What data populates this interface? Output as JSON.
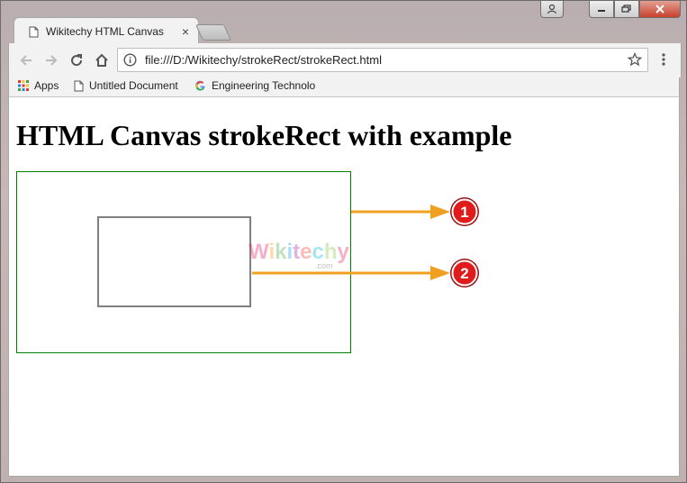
{
  "window": {
    "controls": [
      "profile",
      "minimize",
      "maximize",
      "close"
    ]
  },
  "tabs": [
    {
      "title": "Wikitechy HTML Canvas",
      "close": "×",
      "active": true
    }
  ],
  "toolbar": {
    "url": "file:///D:/Wikitechy/strokeRect/strokeRect.html",
    "icons": [
      "back-icon",
      "forward-icon",
      "reload-icon",
      "home-icon",
      "info-icon",
      "star-icon",
      "menu-icon"
    ]
  },
  "bookmarks": [
    {
      "label": "Apps",
      "icon": "apps-grid-icon"
    },
    {
      "label": "Untitled Document",
      "icon": "document-icon"
    },
    {
      "label": "Engineering Technolo",
      "icon": "google-icon"
    }
  ],
  "page": {
    "heading": "HTML Canvas strokeRect with example",
    "watermark": "Wikitechy",
    "watermark_sub": ".com",
    "callouts": [
      "1",
      "2"
    ]
  },
  "colors": {
    "outer_rect_stroke": "#008000",
    "inner_rect_stroke": "#808080",
    "arrow": "#f0a020",
    "callout_badge": "#e01b1b"
  }
}
